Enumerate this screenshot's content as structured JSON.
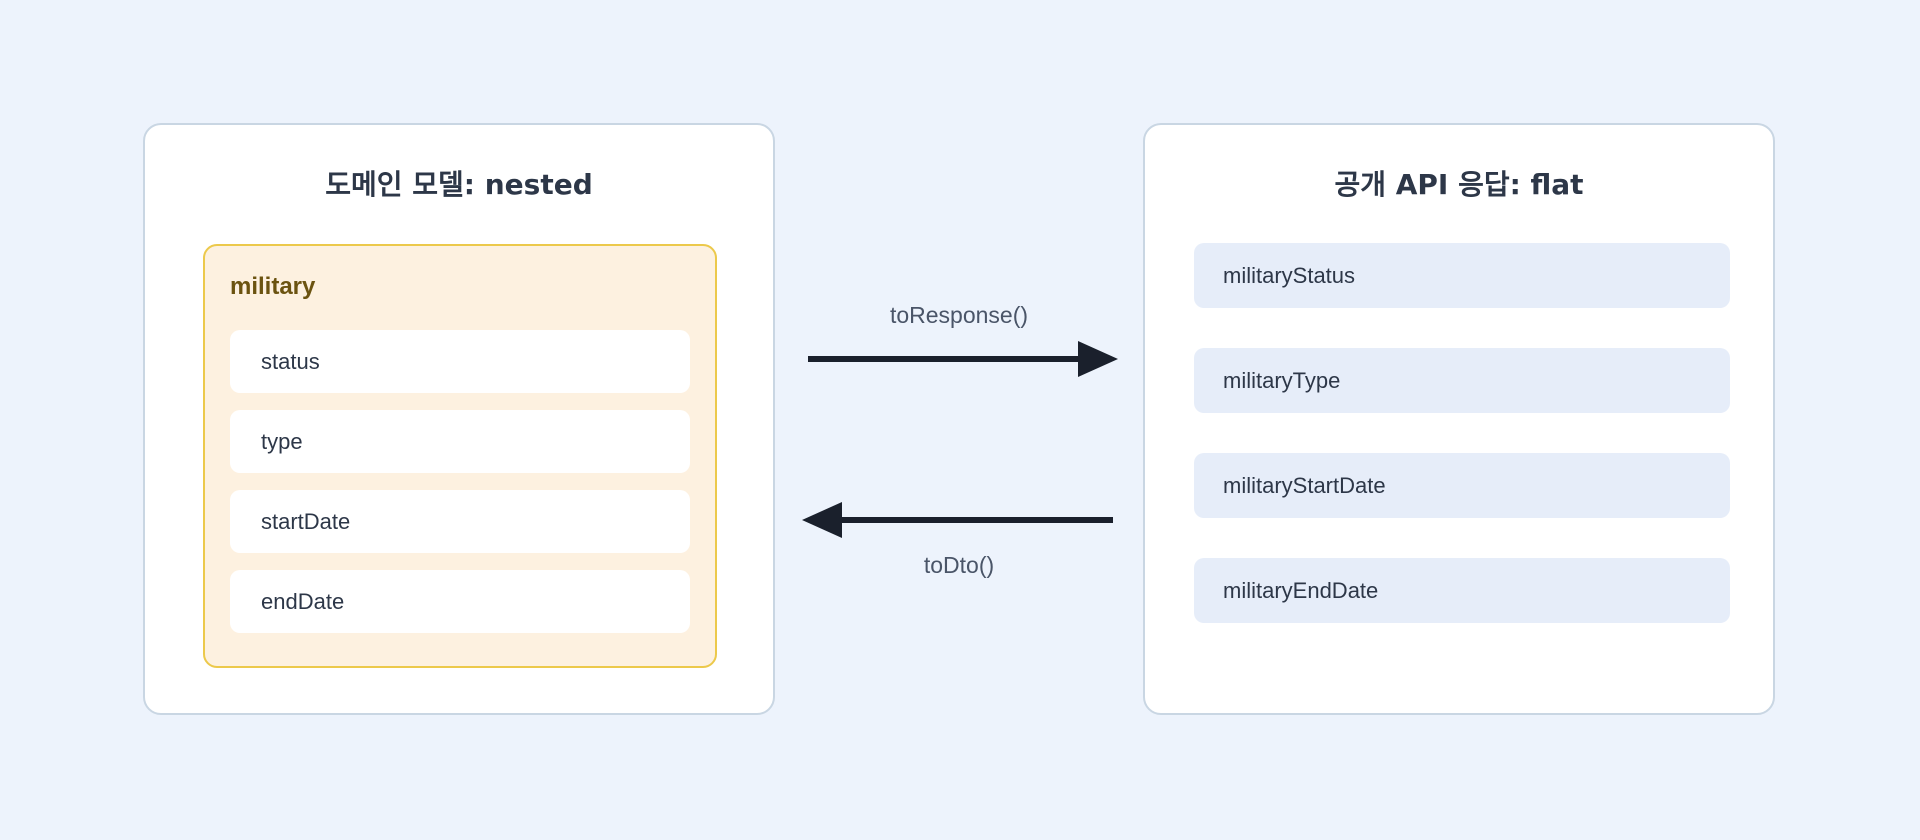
{
  "left_panel": {
    "title": "도메인 모델: nested",
    "group": {
      "label": "military",
      "fields": [
        "status",
        "type",
        "startDate",
        "endDate"
      ]
    }
  },
  "right_panel": {
    "title": "공개 API 응답: flat",
    "fields": [
      "militaryStatus",
      "militaryType",
      "militaryStartDate",
      "militaryEndDate"
    ]
  },
  "arrows": {
    "forward_label": "toResponse()",
    "backward_label": "toDto()"
  },
  "colors": {
    "background": "#edf3fc",
    "group_fill": "#fdf1e0",
    "group_border": "#ecc94b",
    "flat_field_fill": "#e6edf9",
    "arrow": "#1a202c"
  }
}
